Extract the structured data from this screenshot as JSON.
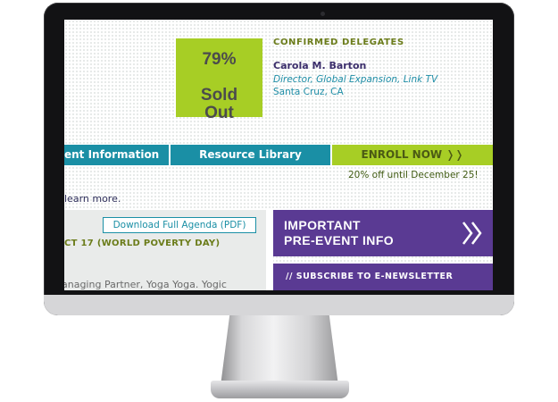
{
  "sold_out": {
    "percent": "79%",
    "label": "Sold\nOut"
  },
  "delegates": {
    "heading": "CONFIRMED DELEGATES",
    "name": "Carola M. Barton",
    "title": "Director, Global Expansion, Link TV",
    "location": "Santa Cruz, CA"
  },
  "nav": {
    "event_info": "ent Information",
    "resource_library": "Resource Library",
    "enroll": "ENROLL NOW ❭❭"
  },
  "promo": {
    "discount": "20% off until December 25!"
  },
  "content": {
    "learn_more": "learn more.",
    "agenda_button": "Download Full Agenda (PDF)",
    "date_heading": "CT 17 (WORLD POVERTY DAY)",
    "partner": "anaging Partner, Yoga Yoga. Yogic"
  },
  "sidebar": {
    "pre_event": "IMPORTANT\nPRE-EVENT INFO",
    "newsletter": "// SUBSCRIBE TO E-NEWSLETTER"
  },
  "colors": {
    "green": "#a7ce25",
    "teal": "#1a8fa5",
    "purple": "#5a3a93"
  }
}
